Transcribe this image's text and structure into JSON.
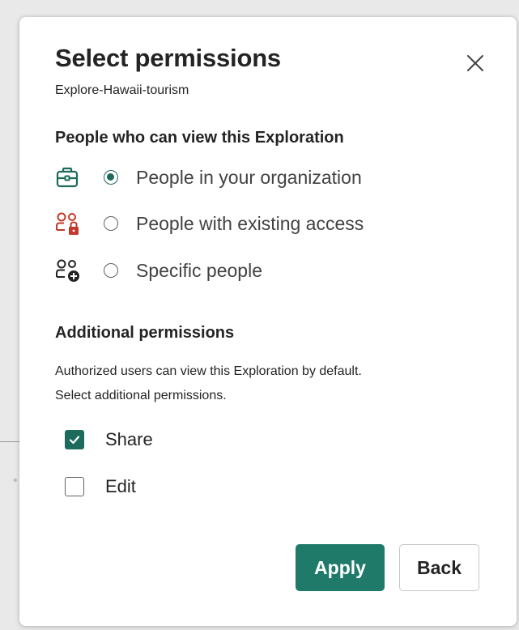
{
  "dialog": {
    "title": "Select permissions",
    "subtitle": "Explore-Hawaii-tourism",
    "close_icon": "close-icon"
  },
  "view_section": {
    "heading": "People who can view this Exploration",
    "options": [
      {
        "icon": "briefcase-icon",
        "icon_color": "#1d6b5c",
        "label": "People in your organization",
        "selected": true
      },
      {
        "icon": "people-lock-icon",
        "icon_color": "#c0392b",
        "label": "People with existing access",
        "selected": false
      },
      {
        "icon": "people-add-icon",
        "icon_color": "#242424",
        "label": "Specific people",
        "selected": false
      }
    ]
  },
  "additional_section": {
    "heading": "Additional permissions",
    "description_line1": "Authorized users can view this Exploration by default.",
    "description_line2": "Select additional permissions.",
    "checkboxes": [
      {
        "label": "Share",
        "checked": true
      },
      {
        "label": "Edit",
        "checked": false
      }
    ]
  },
  "buttons": {
    "apply_label": "Apply",
    "back_label": "Back"
  },
  "colors": {
    "accent": "#1d6b5c",
    "apply_bg": "#1f7a69",
    "lock_red": "#c0392b"
  }
}
